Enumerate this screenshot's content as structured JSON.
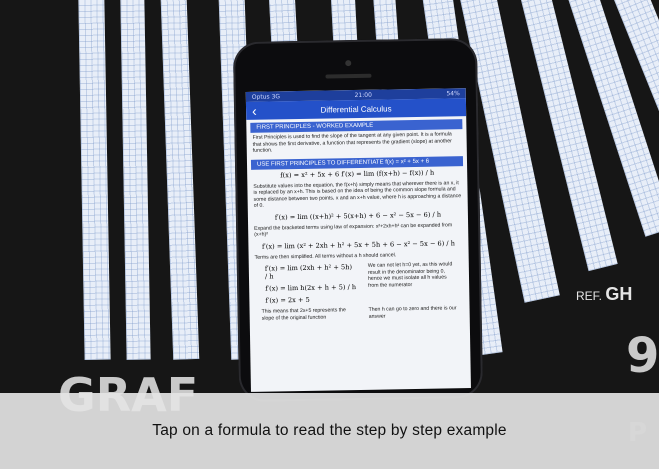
{
  "status": {
    "carrier": "Optus 3G",
    "time": "21:00",
    "battery": "54%"
  },
  "nav": {
    "back_icon": "chevron-left-icon",
    "title": "Differential Calculus"
  },
  "content": {
    "section1_header": "FIRST PRINCIPLES - WORKED EXAMPLE",
    "intro": "First Principles is used to find the slope of the tangent at any given point. It is a formula that shows the first derivative, a function that represents the gradient (slope) at another function.",
    "section2_header": "USE FIRST PRINCIPLES TO DIFFERENTIATE f(x) = x² + 5x + 6",
    "formula1": "f(x) = x² + 5x + 6      f′(x) = lim (f(x+h) − f(x)) / h",
    "para2": "Substitute values into the equation, the f(x+h) simply means that wherever there is an x, it is replaced by an x+h. This is based on the idea of being the common slope formula and some distance between two points, x and an x+h value, where h is approaching a distance of 0.",
    "formula2": "f′(x) = lim ((x+h)² + 5(x+h) + 6 − x² − 5x − 6) / h",
    "para3": "Expand the bracketed terms using law of expansion: x²+2xh+h² can be expanded from (x+h)²",
    "formula3": "f′(x) = lim (x² + 2xh + h² + 5x + 5h + 6 − x² − 5x − 6) / h",
    "para4": "Terms are then simplified. All terms without a h should cancel.",
    "formula4": "f′(x) = lim (2xh + h² + 5h) / h",
    "para5": "We can not let h=0 yet, as this would result in the denominator being 0, hence we must isolate all h values from the numerator",
    "formula5": "f′(x) = lim h(2x + h + 5) / h",
    "formula6": "f′(x) = 2x + 5",
    "para6": "This means that 2x+5 represents the slope of the original function",
    "para7": "Then h can go to zero and there is our answer"
  },
  "background": {
    "big_text": "GRAF",
    "ref_label": "REF.",
    "ref_code": "GH",
    "digit": "9",
    "letter": "P"
  },
  "caption": "Tap on a formula to read the step by step example"
}
